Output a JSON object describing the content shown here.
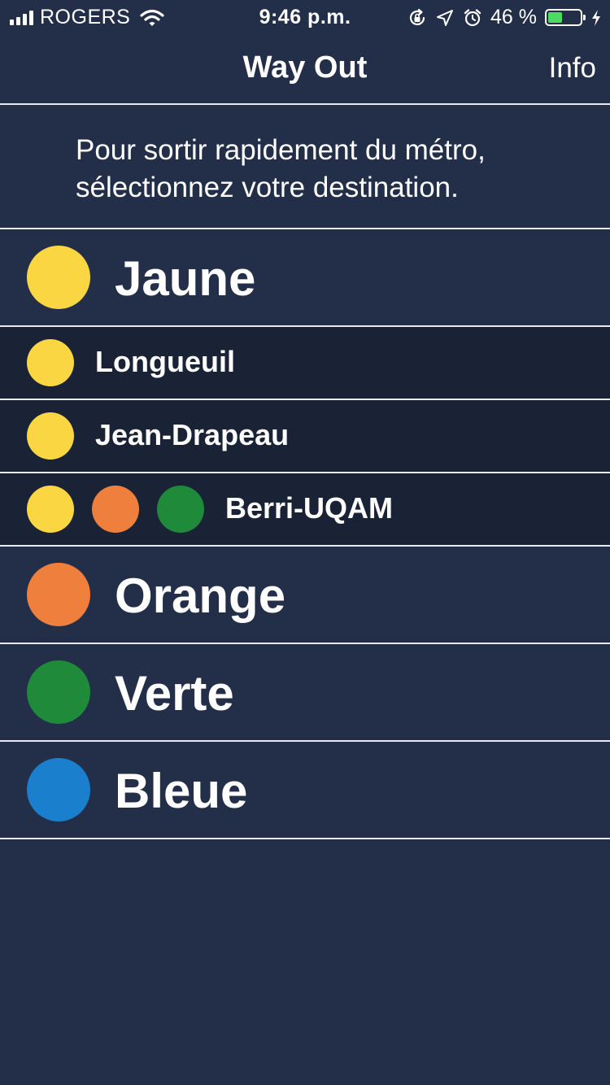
{
  "status_bar": {
    "carrier": "ROGERS",
    "time": "9:46 p.m.",
    "battery_percent": "46 %",
    "battery_level": 0.46,
    "icons": [
      "signal-icon",
      "wifi-icon",
      "rotation-lock-icon",
      "location-icon",
      "alarm-icon",
      "battery-icon",
      "charging-icon"
    ]
  },
  "nav": {
    "title": "Way Out",
    "info_label": "Info"
  },
  "intro": {
    "line1": "Pour sortir rapidement du métro,",
    "line2": "sélectionnez votre destination."
  },
  "colors": {
    "jaune": "#fad643",
    "orange": "#ef7f3c",
    "verte": "#1e8a3a",
    "bleue": "#1a7fcd",
    "background": "#232f48",
    "station_background": "#1a2235"
  },
  "lines": {
    "jaune": {
      "name": "Jaune",
      "stations": {
        "longueuil": "Longueuil",
        "jean_drapeau": "Jean-Drapeau",
        "berri_uqam": "Berri-UQAM"
      }
    },
    "orange": {
      "name": "Orange"
    },
    "verte": {
      "name": "Verte"
    },
    "bleue": {
      "name": "Bleue"
    }
  }
}
